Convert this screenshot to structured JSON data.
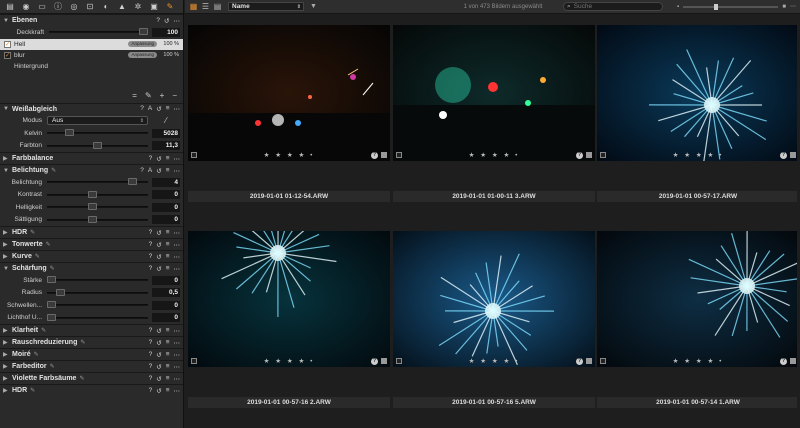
{
  "tool_tabs": [
    {
      "icon": "folder-icon",
      "glyph": "▤"
    },
    {
      "icon": "camera-icon",
      "glyph": "◉"
    },
    {
      "icon": "library-icon",
      "glyph": "▭"
    },
    {
      "icon": "info-icon",
      "glyph": "ⓘ"
    },
    {
      "icon": "lens-icon",
      "glyph": "◎"
    },
    {
      "icon": "crop-icon",
      "glyph": "⊡"
    },
    {
      "icon": "color-icon",
      "glyph": "◐"
    },
    {
      "icon": "details-icon",
      "glyph": "▲"
    },
    {
      "icon": "gear-icon",
      "glyph": "✲"
    },
    {
      "icon": "batch-icon",
      "glyph": "▣"
    },
    {
      "icon": "adjust-brush-icon",
      "glyph": "✎",
      "active": true
    }
  ],
  "layers": {
    "title": "Ebenen",
    "opacity_label": "Deckkraft",
    "opacity_value": "100",
    "items": [
      {
        "name": "Hell",
        "badge": "Anpassung",
        "pct": "100 %",
        "selected": true,
        "checked": true
      },
      {
        "name": "blur",
        "badge": "Anpassung",
        "pct": "100 %",
        "selected": false,
        "checked": true
      },
      {
        "name": "Hintergrund",
        "badge": "",
        "pct": "",
        "selected": false,
        "checked": false
      }
    ]
  },
  "white_balance": {
    "title": "Weißabgleich",
    "mode_label": "Modus",
    "mode_value": "Aus",
    "sliders": [
      {
        "label": "Kelvin",
        "value": "5028",
        "level": 0.2
      },
      {
        "label": "Farbton",
        "value": "11,3",
        "level": 0.5
      }
    ]
  },
  "color_balance": {
    "title": "Farbbalance"
  },
  "exposure": {
    "title": "Belichtung",
    "sliders": [
      {
        "label": "Belichtung",
        "value": "4",
        "level": 0.88
      },
      {
        "label": "Kontrast",
        "value": "0",
        "level": 0.45
      },
      {
        "label": "Helligkeit",
        "value": "0",
        "level": 0.45
      },
      {
        "label": "Sättigung",
        "value": "0",
        "level": 0.45
      }
    ]
  },
  "hdr": {
    "title": "HDR"
  },
  "tone": {
    "title": "Tonwerte"
  },
  "curve": {
    "title": "Kurve"
  },
  "sharpening": {
    "title": "Schärfung",
    "sliders": [
      {
        "label": "Stärke",
        "value": "0",
        "level": 0.0
      },
      {
        "label": "Radius",
        "value": "0,5",
        "level": 0.1
      },
      {
        "label": "Schwellen...",
        "value": "0",
        "level": 0.0
      },
      {
        "label": "Lichthof U...",
        "value": "0",
        "level": 0.0
      }
    ]
  },
  "collapsed_sections": [
    "Klarheit",
    "Rauschreduzierung",
    "Moiré",
    "Farbeditor",
    "Violette Farbsäume",
    "HDR"
  ],
  "toolbar": {
    "sort_value": "Name",
    "count_text": "1 von 473 Bildern ausgewählt",
    "search_placeholder": "Suche"
  },
  "thumbnails": [
    {
      "filename": "2019-01-01 01-12-54.ARW",
      "stars": "★ ★ ★ ★ •"
    },
    {
      "filename": "2019-01-01 01-00-11 3.ARW",
      "stars": "★ ★ ★ ★ •"
    },
    {
      "filename": "2019-01-01 00-57-17.ARW",
      "stars": "★ ★ ★ ★ •"
    },
    {
      "filename": "2019-01-01 00-57-16 2.ARW",
      "stars": "★ ★ ★ ★ •"
    },
    {
      "filename": "2019-01-01 00-57-16 5.ARW",
      "stars": "★ ★ ★ ★ •"
    },
    {
      "filename": "2019-01-01 00-57-14 1.ARW",
      "stars": "★ ★ ★ ★ •"
    }
  ],
  "colors": {
    "accent": "#e8902c",
    "panel": "#2a2a2a",
    "background": "#1e1e1e"
  }
}
